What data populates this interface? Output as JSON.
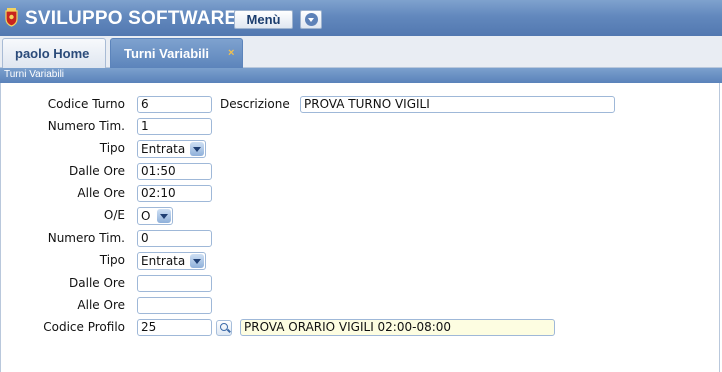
{
  "header": {
    "app_title": "SVILUPPO SOFTWARE",
    "menu_label": "Menù",
    "logo_icon": "coat-of-arms-icon",
    "menu_dropdown_icon": "chevron-down-icon"
  },
  "tabs": [
    {
      "label": "paolo Home",
      "active": false
    },
    {
      "label": "Turni Variabili",
      "active": true,
      "close_label": "×"
    }
  ],
  "panel": {
    "title": "Turni Variabili"
  },
  "form": {
    "codice_turno": {
      "label": "Codice Turno",
      "value": "6"
    },
    "descrizione": {
      "label": "Descrizione",
      "value": "PROVA TURNO VIGILI"
    },
    "numero_tim_1": {
      "label": "Numero Tim.",
      "value": "1"
    },
    "tipo_1": {
      "label": "Tipo",
      "value": "Entrata"
    },
    "dalle_ore_1": {
      "label": "Dalle Ore",
      "value": "01:50"
    },
    "alle_ore_1": {
      "label": "Alle Ore",
      "value": "02:10"
    },
    "oe": {
      "label": "O/E",
      "value": "O"
    },
    "numero_tim_2": {
      "label": "Numero Tim.",
      "value": "0"
    },
    "tipo_2": {
      "label": "Tipo",
      "value": "Entrata"
    },
    "dalle_ore_2": {
      "label": "Dalle Ore",
      "value": ""
    },
    "alle_ore_2": {
      "label": "Alle Ore",
      "value": ""
    },
    "codice_profilo": {
      "label": "Codice Profilo",
      "value": "25",
      "search_icon": "search-icon",
      "description": "PROVA ORARIO VIGILI 02:00-08:00"
    }
  },
  "colors": {
    "header_blue": "#6288bd",
    "readonly_yellow": "#fdfde1",
    "input_border": "#9fb8d8"
  }
}
